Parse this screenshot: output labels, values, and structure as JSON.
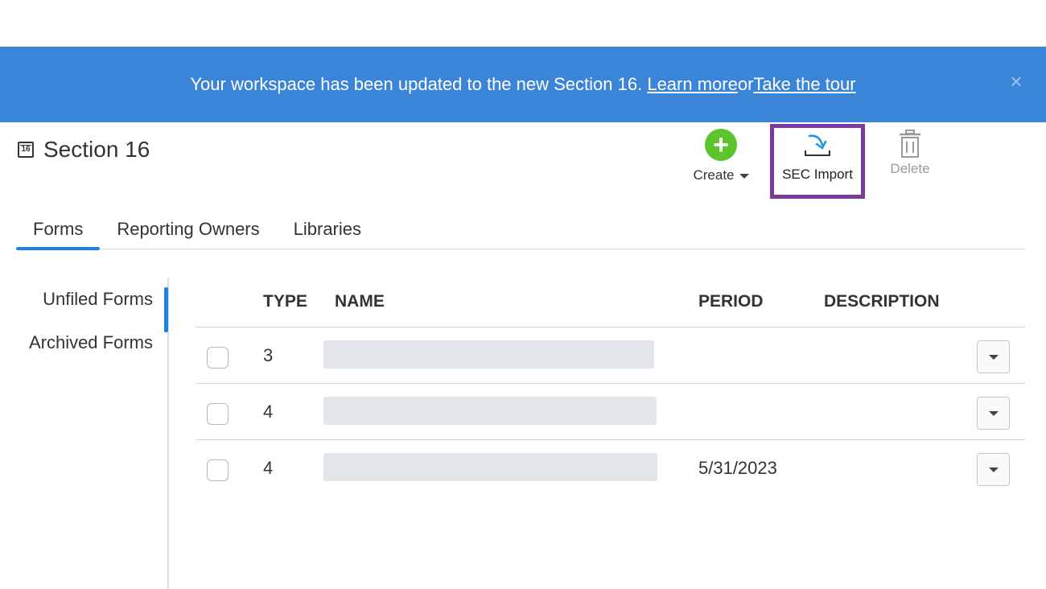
{
  "banner": {
    "message": "Your workspace has been updated to the new Section 16. ",
    "learn_more": "Learn more",
    "or": " or ",
    "take_tour": "Take the tour",
    "close": "×"
  },
  "page": {
    "icon_number": "16",
    "title": "Section 16"
  },
  "toolbar": {
    "create_icon": "+",
    "create_label": "Create",
    "import_label": "SEC Import",
    "delete_label": "Delete"
  },
  "tabs": [
    {
      "label": "Forms",
      "active": true
    },
    {
      "label": "Reporting Owners",
      "active": false
    },
    {
      "label": "Libraries",
      "active": false
    }
  ],
  "sidebar": {
    "items": [
      {
        "label": "Unfiled Forms",
        "active": true
      },
      {
        "label": "Archived Forms",
        "active": false
      }
    ]
  },
  "table": {
    "headers": {
      "type": "TYPE",
      "name": "NAME",
      "period": "PERIOD",
      "description": "DESCRIPTION"
    },
    "rows": [
      {
        "type": "3",
        "period": "",
        "description": ""
      },
      {
        "type": "4",
        "period": "",
        "description": ""
      },
      {
        "type": "4",
        "period": "5/31/2023",
        "description": ""
      }
    ]
  },
  "colors": {
    "banner": "#3b85d8",
    "accent": "#1b82e6",
    "create_green": "#5cc52a",
    "highlight_box": "#7b3a9e"
  },
  "icons": {
    "page": "calendar-icon",
    "create": "plus-circle-icon",
    "import": "import-arrow-icon",
    "delete": "trash-icon",
    "close": "close-icon"
  }
}
